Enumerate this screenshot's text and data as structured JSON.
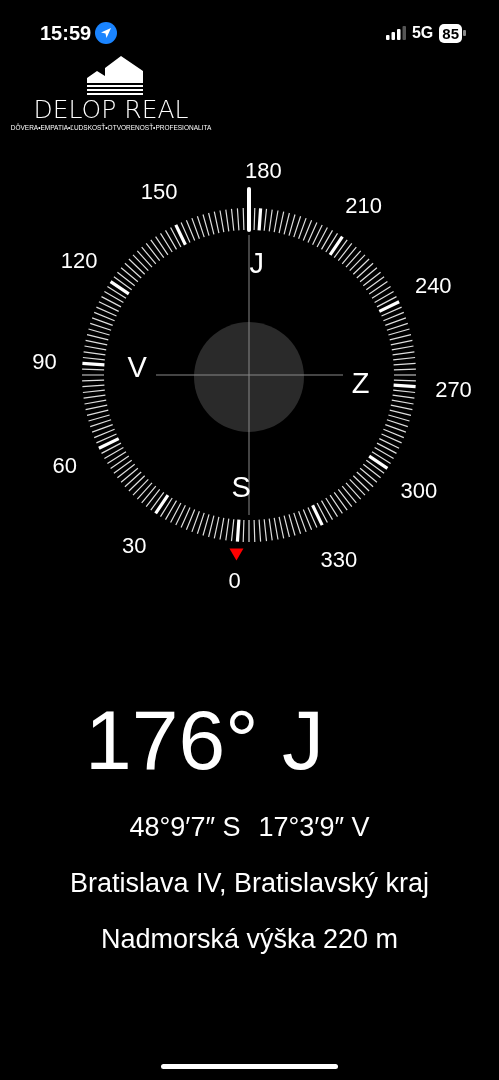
{
  "status_bar": {
    "time": "15:59",
    "network": "5G",
    "battery": "85"
  },
  "logo": {
    "name": "DELOP REAL",
    "tagline": "DÔVERA•EMPATIA•ĽUDSKOSŤ•OTVORENOSŤ•PROFESIONALITA"
  },
  "compass": {
    "dial_labels": [
      "0",
      "30",
      "60",
      "90",
      "120",
      "150",
      "180",
      "210",
      "240",
      "270",
      "300",
      "330"
    ],
    "cardinals": [
      "S",
      "V",
      "J",
      "Z"
    ]
  },
  "readout": {
    "heading": "176° J",
    "latitude": "48°9′7″ S",
    "longitude": "17°3′9″ V",
    "place": "Bratislava IV, Bratislavský kraj",
    "altitude": "Nadmorská výška 220 m"
  }
}
